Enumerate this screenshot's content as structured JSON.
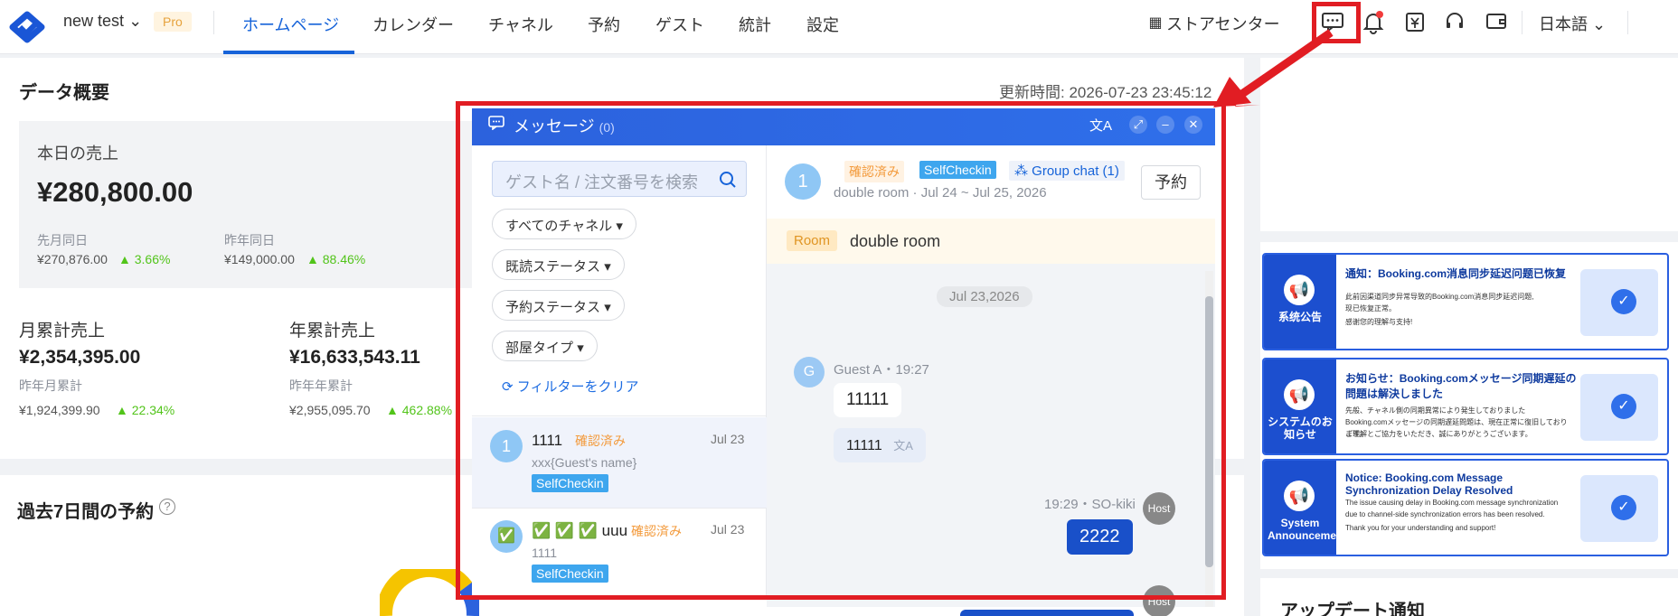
{
  "topbar": {
    "account": "new test",
    "pro_badge": "Pro",
    "nav": [
      "ホームページ",
      "カレンダー",
      "チャネル",
      "予約",
      "ゲスト",
      "統計",
      "設定"
    ],
    "store_center": "ストアセンター",
    "language": "日本語"
  },
  "overview": {
    "title": "データ概要",
    "updated": "更新時間:  2026-07-23 23:45:12",
    "today_sales_label": "本日の売上",
    "today_sales": "¥280,800.00",
    "prev_month_label": "先月同日",
    "prev_month_value": "¥270,876.00",
    "prev_month_pct": "3.66%",
    "prev_year_label": "昨年同日",
    "prev_year_value": "¥149,000.00",
    "prev_year_pct": "88.46%",
    "monthly_label": "月累計売上",
    "monthly_value": "¥2,354,395.00",
    "monthly_sub_label": "昨年月累計",
    "monthly_sub_value": "¥1,924,399.90",
    "monthly_sub_pct": "22.34%",
    "yearly_label": "年累計売上",
    "yearly_value": "¥16,633,543.11",
    "yearly_sub_label": "昨年年累計",
    "yearly_sub_value": "¥2,955,095.70",
    "yearly_sub_pct": "462.88%"
  },
  "bookings7": {
    "title": "過去7日間の予約"
  },
  "modal": {
    "title": "メッセージ",
    "count": "(0)",
    "search_placeholder": "ゲスト名 / 注文番号を検索",
    "filters": [
      "すべてのチャネル",
      "既読ステータス",
      "予約ステータス",
      "部屋タイプ"
    ],
    "clear_filters": "フィルターをクリア",
    "conversations": [
      {
        "avatar": "1",
        "name": "1111",
        "status": "確認済み",
        "date": "Jul 23",
        "preview": "xxx{Guest's name}",
        "tag": "SelfCheckin"
      },
      {
        "avatar": "✅",
        "name": "✅ ✅ ✅ uuu",
        "status": "確認済み",
        "date": "Jul 23",
        "preview": "1111",
        "tag": "SelfCheckin"
      }
    ],
    "header": {
      "avatar": "1",
      "status": "確認済み",
      "tag": "SelfCheckin",
      "group_chat": "Group chat (1)",
      "sub": "double room · Jul 24 ~ Jul 25, 2026",
      "book_button": "予約"
    },
    "room_tag": "Room",
    "room_name": "double room",
    "date_chip": "Jul 23,2026",
    "guest_meta": "Guest A・19:27",
    "guest_avatar": "G",
    "guest_msg1": "11111",
    "guest_msg2": "11111",
    "host_meta": "19:29・SO-kiki",
    "host_avatar": "Host",
    "host_msg": "2222",
    "host_avatar2": "Host"
  },
  "banners": [
    {
      "side": "系统公告",
      "title": "通知：Booking.com消息同步延迟问题已恢复",
      "desc1": "此前因渠道同步异常导致的Booking.com消息同步延迟问题,",
      "desc2": "现已恢复正常。",
      "desc3": "感谢您的理解与支持!"
    },
    {
      "side": "システムのお知らせ",
      "title": "お知らせ：Booking.comメッセージ同期遅延の問題は解決しました",
      "desc1": "先般、チャネル側の同期異常により発生しておりました",
      "desc2": "Booking.comメッセージの同期遅延問題は、現在正常に復旧しております。",
      "desc3": "ご理解とご協力をいただき、誠にありがとうございます。"
    },
    {
      "side": "System Announcement",
      "title": "Notice: Booking.com Message Synchronization Delay Resolved",
      "desc1": "The issue causing delay in Booking.com message synchronization",
      "desc2": "due to channel-side synchronization errors has been resolved.",
      "desc3": "Thank you for your understanding and support!"
    }
  ],
  "update_notice": "アップデート通知",
  "colors": {
    "accent": "#1663d9",
    "highlight": "#e11d23",
    "success": "#52c41a"
  }
}
